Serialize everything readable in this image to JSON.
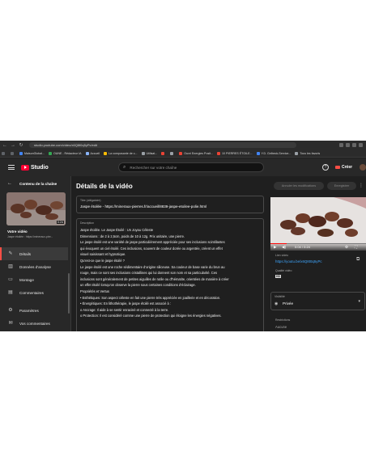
{
  "browser": {
    "url": "studio.youtube.com/video/x6Q8t0q5yPc/edit",
    "bookmarks": [
      {
        "label": "",
        "color": "#5f6368"
      },
      {
        "label": "",
        "color": "#5f6368"
      },
      {
        "label": "MaisonGlobal...",
        "color": "#4285f4"
      },
      {
        "label": "OUNE - Rédacteur IA",
        "color": "#34a853"
      },
      {
        "label": "Accueil",
        "color": "#8ab4f8"
      },
      {
        "label": "La composante de c...",
        "color": "#fbbc04"
      },
      {
        "label": "Utilisat...",
        "color": "#9aa0a6"
      },
      {
        "label": "",
        "color": "#ea4335"
      },
      {
        "label": "",
        "color": "#9aa0a6"
      },
      {
        "label": "Ouvri Energies Posit...",
        "color": "#ea4335"
      },
      {
        "label": "10 PIERRES ÉTOILE...",
        "color": "#ea4335"
      },
      {
        "label": "Y.D. Gelbeck-Service...",
        "color": "#4285f4"
      },
      {
        "label": "Tous les favoris",
        "color": "#9aa0a6"
      }
    ]
  },
  "header": {
    "app_name": "Studio",
    "search_placeholder": "Rechercher sur votre chaîne",
    "create_label": "Créer",
    "help_icon": "?"
  },
  "sidebar": {
    "title": "Contenu de la chaîne",
    "thumbnail_duration": "0:24",
    "video_label": "Votre vidéo",
    "video_description": "Jaspe étoilée : https://mineraux-pier...",
    "items": [
      {
        "label": "Détails",
        "icon": "pencil-icon",
        "glyph": "✎",
        "active": true
      },
      {
        "label": "Données d'analyse",
        "icon": "analytics-icon",
        "glyph": "▥",
        "active": false
      },
      {
        "label": "Montage",
        "icon": "editor-icon",
        "glyph": "▭",
        "active": false
      },
      {
        "label": "Commentaires",
        "icon": "comments-icon",
        "glyph": "▤",
        "active": false
      },
      {
        "label": "Paramètres",
        "icon": "settings-icon",
        "glyph": "⚙",
        "active": false
      },
      {
        "label": "Vos commentaires",
        "icon": "feedback-icon",
        "glyph": "✉",
        "active": false
      }
    ]
  },
  "main": {
    "page_title": "Détails de la vidéo",
    "undo_label": "Annuler les modifications",
    "save_label": "Enregistrer",
    "title_field": {
      "label": "Titre (obligatoire)",
      "value": "Jaspe étoilée - https://mineraux-pierres.fr/accueil/8839-jaspe-etoilee-polie.html"
    },
    "description_field": {
      "label": "Description",
      "lines": [
        "Jaspe étoilée. Le Jaspe Étoilé : Un Joyau Céleste",
        "Dimensions : de 2 à 2,5cm, poids de 10 à 12g. Prix unitaire, une pierre.",
        "Le jaspe étoilé est une variété de jaspe particulièrement appréciée pour ses inclusions scintillantes",
        "qui évoquent un ciel étoilé. Ces inclusions, souvent de couleur dorée ou argentée, créent un effet",
        "visuel saisissant et hypnotique.",
        "Qu'est-ce que le jaspe étoilé ?",
        "Le jaspe étoilé est une roche sédimentaire d'origine siliceuse. Sa couleur de base varie du brun au",
        "rouge, mais ce sont ses inclusions cristallines qui lui donnent son nom et sa particularité. Ces",
        "inclusions sont généralement de petites aiguilles de rutile ou d'hématite, orientées de manière à créer",
        "un effet étoilé lorsqu'on observe la pierre sous certaines conditions d'éclairage.",
        "Propriétés et Vertus",
        "• Esthétiques: Son aspect céleste en fait une pierre très appréciée en joaillerie et en décoration.",
        "• Énergétiques: En lithothérapie, le jaspe étoilé est associé à :",
        "o Ancrage: Il aide à se sentir enraciné et connecté à la terre.",
        "o Protection: Il est considéré comme une pierre de protection qui éloigne les énergies négatives."
      ]
    },
    "player": {
      "time": "0:04 / 0:24",
      "progress": 0.17
    },
    "video_link_label": "Lien vidéo",
    "video_link": "https://youtu.be/x6Q8t0q5yPc",
    "quality_label": "Qualité vidéo",
    "quality_badge": "HD",
    "visibility_label": "Visibilité",
    "visibility_value": "Privée",
    "restrictions_label": "Restrictions",
    "restrictions_value": "Aucune"
  }
}
